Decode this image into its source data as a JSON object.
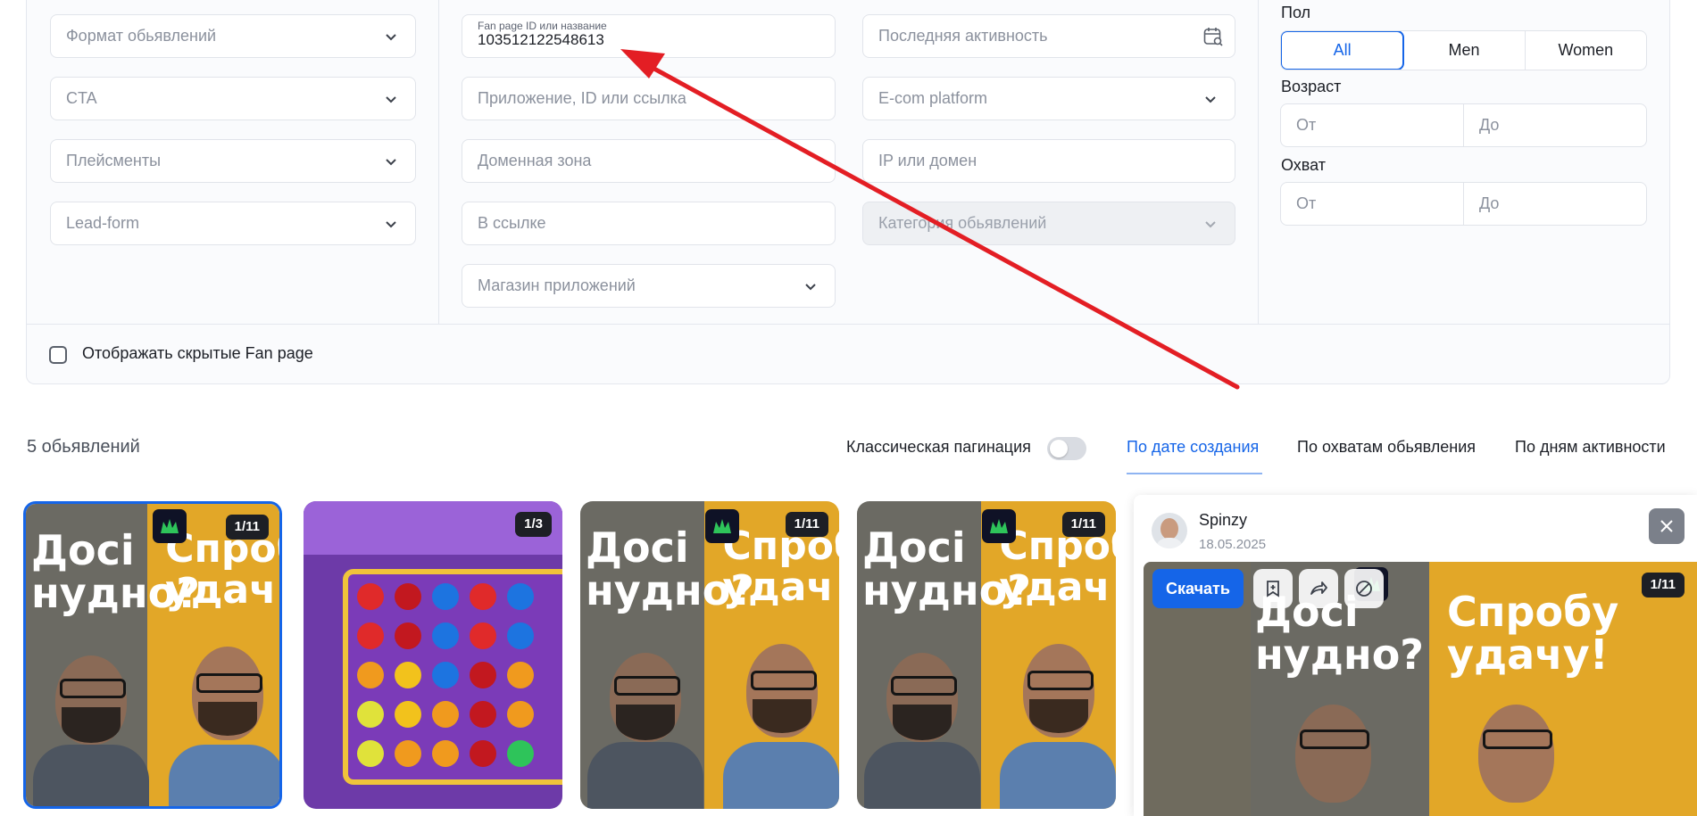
{
  "filters": {
    "col1": [
      {
        "placeholder": "Формат обьявлений"
      },
      {
        "placeholder": "CTA"
      },
      {
        "placeholder": "Плейсменты"
      },
      {
        "placeholder": "Lead-form"
      }
    ],
    "col2": {
      "fanpage_label": "Fan page ID или название",
      "fanpage_value": "103512122548613",
      "app_placeholder": "Приложение, ID или ссылка",
      "domain_placeholder": "Доменная зона",
      "link_placeholder": "В ссылке",
      "store_placeholder": "Магазин приложений"
    },
    "col3": {
      "activity_placeholder": "Последняя активность",
      "ecom_placeholder": "E-com platform",
      "ip_placeholder": "IP или домен",
      "category_placeholder": "Категория обьявлений"
    },
    "col4": {
      "gender_label": "Пол",
      "gender_options": [
        "All",
        "Men",
        "Women"
      ],
      "gender_selected": "All",
      "age_label": "Возраст",
      "reach_label": "Охват",
      "from_placeholder": "От",
      "to_placeholder": "До"
    },
    "hidden_fanpage_label": "Отображать скрытые Fan page",
    "hidden_fanpage_checked": false
  },
  "results": {
    "count_label": "5 обьявлений",
    "pagination_label": "Классическая пагинация",
    "pagination_enabled": false,
    "sort_tabs": [
      "По дате создания",
      "По охватам обьявления",
      "По дням активности"
    ],
    "sort_active": "По дате создания"
  },
  "cards": [
    {
      "counter": "1/11",
      "headline_left": "Досі\nнудно?",
      "headline_right": "Спроб\nудач",
      "selected": true
    },
    {
      "counter": "1/3",
      "type": "slot"
    },
    {
      "counter": "1/11",
      "headline_left": "Досі\nнудно?",
      "headline_right": "Спроб\nудач"
    },
    {
      "counter": "1/11",
      "headline_left": "Досі\nнудно?",
      "headline_right": "Спроб\nудач"
    }
  ],
  "detail_panel": {
    "page_name": "Spinzy",
    "date": "18.05.2025",
    "download_label": "Скачать",
    "counter": "1/11",
    "headline_left": "Досі\nнудно?",
    "headline_right": "Спробу\nудачу!"
  },
  "colors": {
    "accent": "#1565e8",
    "annotation_arrow": "#e31e24"
  },
  "icons": [
    "chevron-down-icon",
    "calendar-search-icon",
    "close-icon",
    "bookmark-icon",
    "share-icon",
    "block-icon",
    "crown-logo-icon"
  ]
}
